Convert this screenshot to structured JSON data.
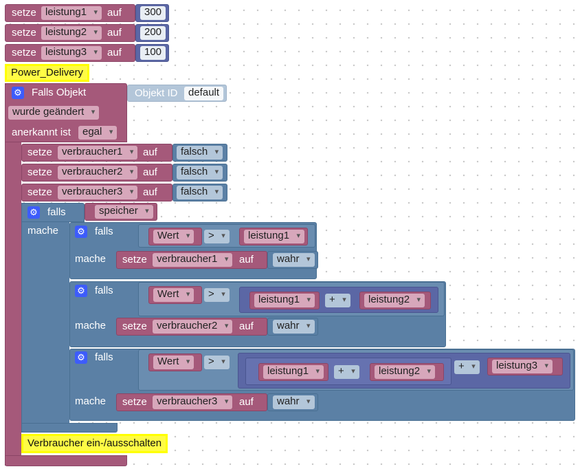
{
  "top_setters": [
    {
      "setze": "setze",
      "var": "leistung1",
      "auf": "auf",
      "value": "300"
    },
    {
      "setze": "setze",
      "var": "leistung2",
      "auf": "auf",
      "value": "200"
    },
    {
      "setze": "setze",
      "var": "leistung3",
      "auf": "auf",
      "value": "100"
    }
  ],
  "comment_top": "Power_Delivery",
  "event": {
    "title": "Falls Objekt",
    "objekt_id_label": "Objekt ID",
    "objekt_id_value": "default",
    "trigger": "wurde geändert",
    "anerkannt_label": "anerkannt ist",
    "anerkannt_value": "egal"
  },
  "resets": [
    {
      "setze": "setze",
      "var": "verbraucher1",
      "auf": "auf",
      "value": "falsch"
    },
    {
      "setze": "setze",
      "var": "verbraucher2",
      "auf": "auf",
      "value": "falsch"
    },
    {
      "setze": "setze",
      "var": "verbraucher3",
      "auf": "auf",
      "value": "falsch"
    }
  ],
  "outer_if": {
    "falls": "falls",
    "cond": "speicher",
    "mache": "mache"
  },
  "inner_ifs": [
    {
      "falls": "falls",
      "left": "Wert",
      "op": ">",
      "right": "leistung1",
      "mache": "mache",
      "setze": "setze",
      "target": "verbraucher1",
      "auf": "auf",
      "value": "wahr"
    },
    {
      "falls": "falls",
      "left": "Wert",
      "op": ">",
      "sum_a": "leistung1",
      "plus": "+",
      "sum_b": "leistung2",
      "mache": "mache",
      "setze": "setze",
      "target": "verbraucher2",
      "auf": "auf",
      "value": "wahr"
    },
    {
      "falls": "falls",
      "left": "Wert",
      "op": ">",
      "sum_a": "leistung1",
      "plus1": "+",
      "sum_b": "leistung2",
      "plus2": "+",
      "sum_c": "leistung3",
      "mache": "mache",
      "setze": "setze",
      "target": "verbraucher3",
      "auf": "auf",
      "value": "wahr"
    }
  ],
  "comment_bottom": "Verbraucher ein-/ausschalten",
  "colors": {
    "variable": "#a5597a",
    "logic": "#5b80a5",
    "math": "#5b67a5",
    "comment": "#ffff00",
    "gear": "#3d5cfb"
  }
}
